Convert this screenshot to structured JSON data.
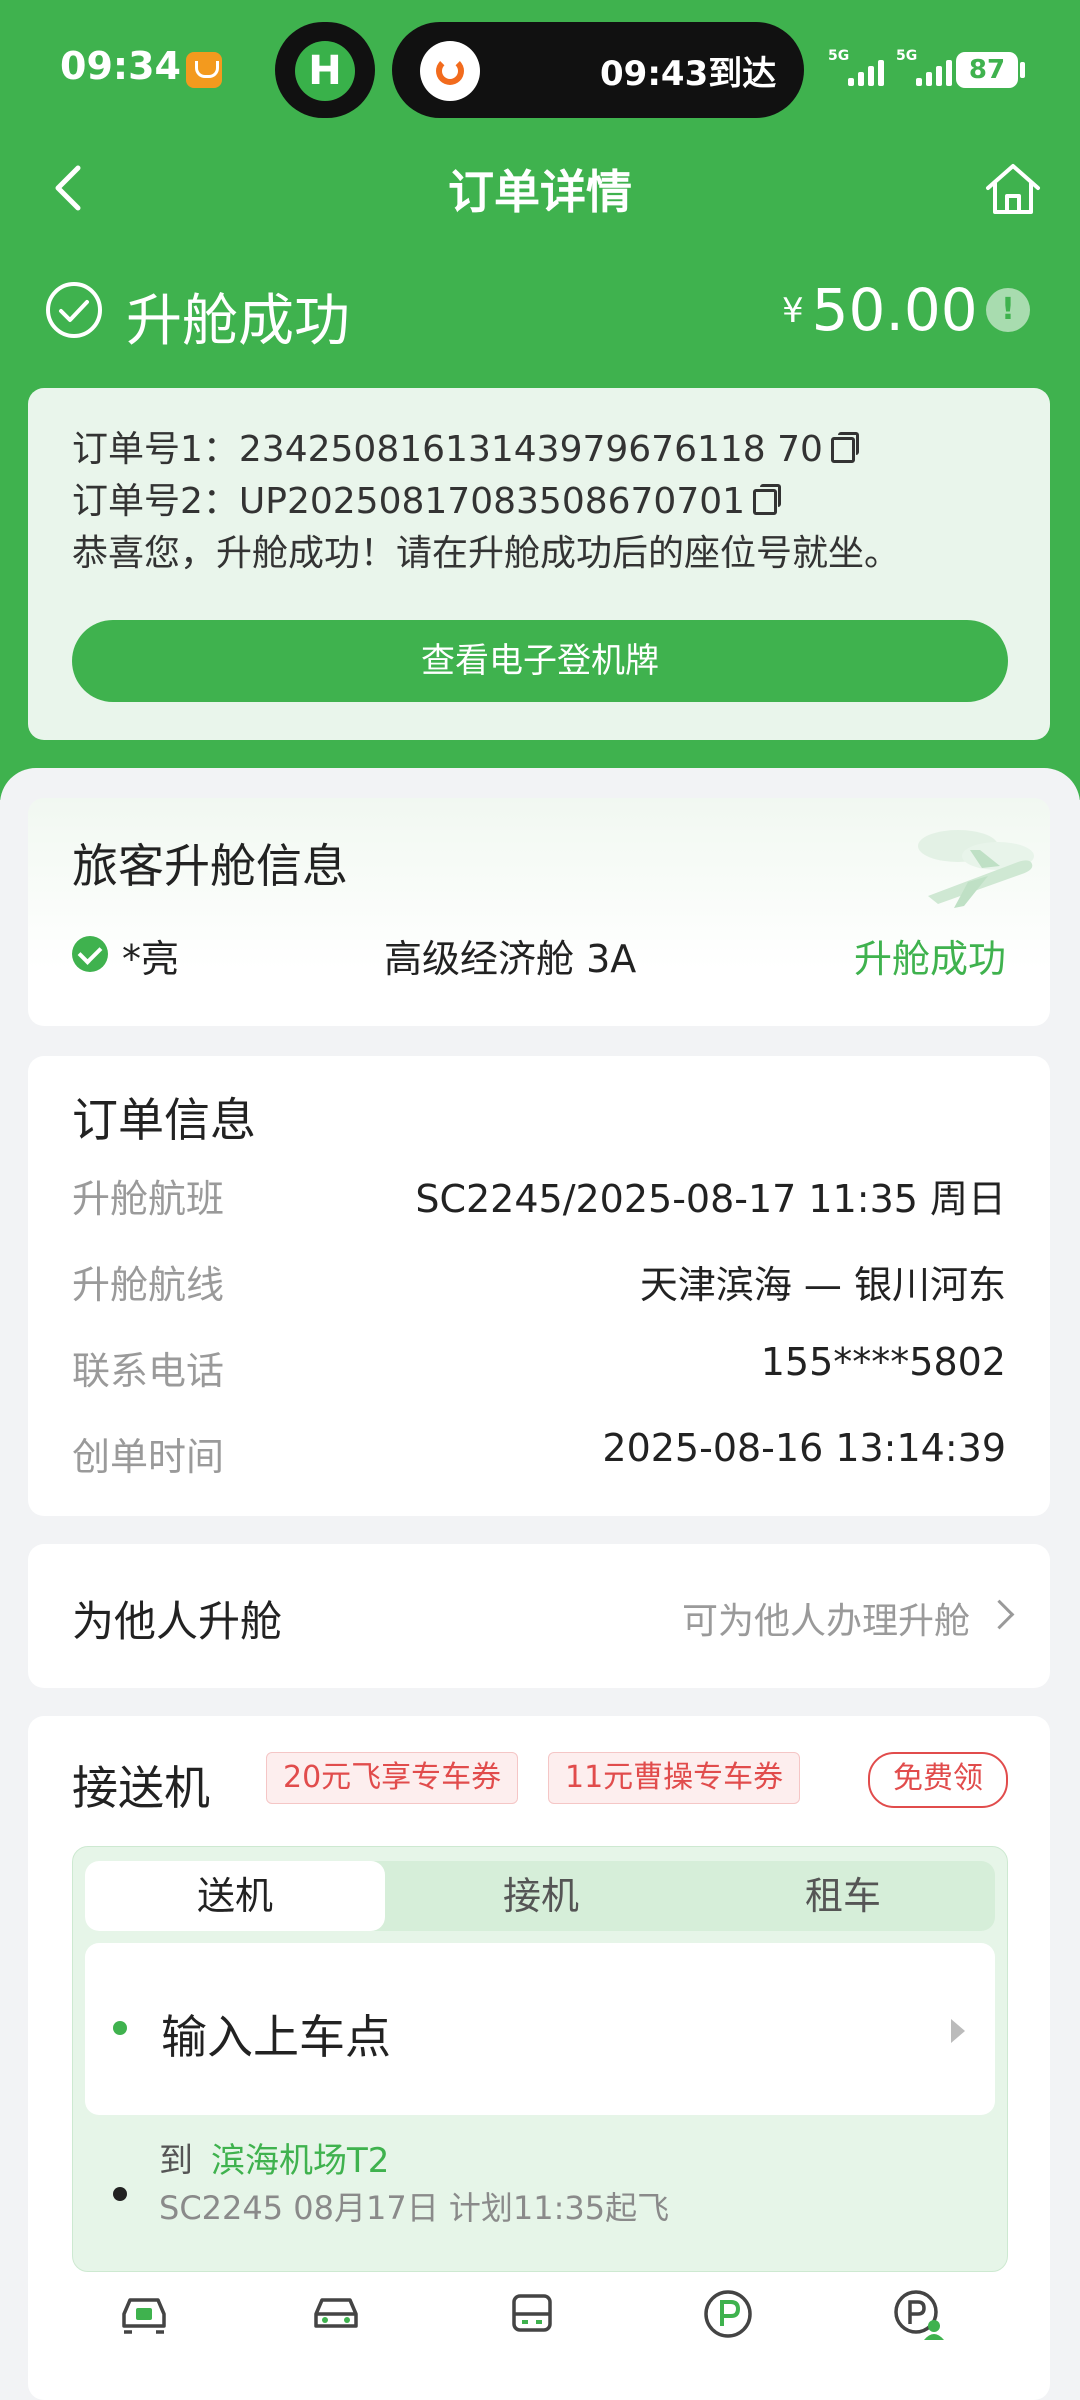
{
  "status_bar": {
    "time": "09:34",
    "island_left_glyph": "H",
    "island_text": "09:43到达",
    "net1": "5G",
    "net2": "5G",
    "battery": "87"
  },
  "nav": {
    "title": "订单详情"
  },
  "header": {
    "success_title": "升舱成功",
    "price_symbol": "¥",
    "price": "50.00",
    "info_glyph": "!"
  },
  "order_box": {
    "order_no_1": "订单号1：23425081613143979676118 70",
    "order_no_2": "订单号2：UP20250817083508670701",
    "message": "恭喜您，升舱成功！请在升舱成功后的座位号就坐。",
    "boarding_pass_button": "查看电子登机牌"
  },
  "passenger": {
    "title": "旅客升舱信息",
    "name": "*亮",
    "seat": "高级经济舱 3A",
    "status": "升舱成功"
  },
  "order_info": {
    "title": "订单信息",
    "rows": [
      {
        "label": "升舱航班",
        "value": "SC2245/2025-08-17 11:35 周日"
      },
      {
        "label": "升舱航线",
        "value": "天津滨海 — 银川河东"
      },
      {
        "label": "联系电话",
        "value": "155****5802"
      },
      {
        "label": "创单时间",
        "value": "2025-08-16 13:14:39"
      }
    ]
  },
  "others": {
    "title": "为他人升舱",
    "hint": "可为他人办理升舱"
  },
  "transfer": {
    "title": "接送机",
    "coupons": [
      "20元飞享专车券",
      "11元曹操专车券"
    ],
    "free_button": "免费领",
    "tabs": [
      "送机",
      "接机",
      "租车"
    ],
    "pickup_placeholder": "输入上车点",
    "dest_prefix": "到",
    "dest_name": "滨海机场T2",
    "flight_info": "SC2245 08月17日 计划11:35起飞"
  },
  "colors": {
    "brand_green": "#3fb24e",
    "coupon_red": "#e14c4c"
  },
  "icons": [
    "back-icon",
    "home-icon",
    "check-circle-icon",
    "info-icon",
    "copy-icon",
    "plane-icon",
    "chevron-right-icon",
    "car-icon",
    "bus-icon",
    "parking-icon"
  ]
}
